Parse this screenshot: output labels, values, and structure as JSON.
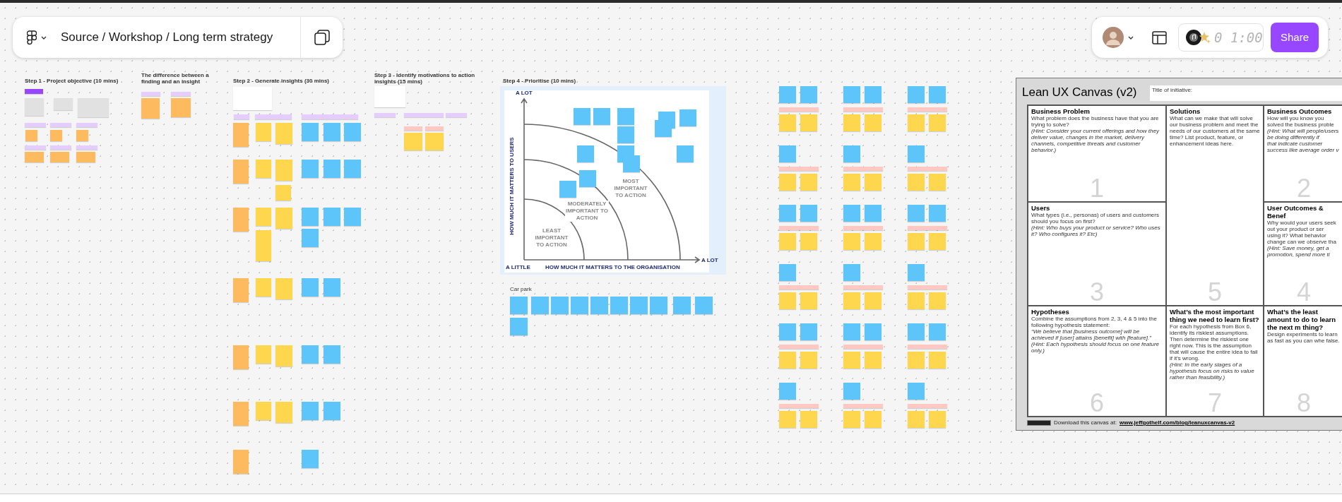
{
  "toolbar": {
    "file_path": "Source / Workshop / Long term strategy",
    "timer": "0 1:00",
    "share_button": "Share"
  },
  "sections": [
    {
      "title": "Step 1 - Project objective (10 mins)"
    },
    {
      "title": "The difference between a finding and an insight"
    },
    {
      "title": "Step 2 - Generate insights (30 mins)"
    },
    {
      "title": "Step 3 - Identify motivations to action insights (15 mins)"
    },
    {
      "title": "Step 4 - Prioritise (10 mins)"
    }
  ],
  "prioritisation_chart": {
    "y_max_label": "A LOT",
    "y_axis_label": "HOW MUCH IT MATTERS TO USERS",
    "origin_label": "A LITTLE",
    "x_axis_label": "HOW MUCH IT MATTERS TO THE ORGANISATION",
    "x_max_label": "A LOT",
    "zones": [
      "LEAST IMPORTANT TO ACTION",
      "MODERATELY IMPORTANT TO ACTION",
      "MOST IMPORTANT TO ACTION"
    ]
  },
  "car_park": {
    "title": "Car park"
  },
  "lean_ux_canvas": {
    "title": "Lean UX Canvas (v2)",
    "initiative_label": "Title of initiative:",
    "boxes": [
      {
        "number": "1",
        "heading": "Business Problem",
        "paragraphs": [
          {
            "text": "What problem does the business have that you are trying to solve?",
            "italic": false
          },
          {
            "text": "(Hint: Consider your current offerings and how they deliver value, changes in the market, delivery channels, competitive threats and customer behavior.)",
            "italic": true
          }
        ]
      },
      {
        "number": "5",
        "heading": "Solutions",
        "paragraphs": [
          {
            "text": "What can we make that will solve our business problem and meet the needs of our customers at the same time? List product, feature, or enhancement ideas here.",
            "italic": false
          }
        ]
      },
      {
        "number": "2",
        "heading": "Business Outcomes",
        "paragraphs": [
          {
            "text": "How will you know you solved the business proble",
            "italic": false
          },
          {
            "text": "(Hint: What will people/users be doing differently if",
            "italic": true
          },
          {
            "text": "that indicate customer success like average order v",
            "italic": true
          }
        ]
      },
      {
        "number": "3",
        "heading": "Users",
        "paragraphs": [
          {
            "text": "What types (i.e., personas) of users and customers should you focus on first?",
            "italic": false
          },
          {
            "text": "(Hint: Who buys your product or service? Who uses it? Who configures it? Etc)",
            "italic": true
          }
        ]
      },
      {
        "number": "4",
        "heading": "User Outcomes & Benef",
        "paragraphs": [
          {
            "text": "Why would your users seek out your product or ser",
            "italic": false
          },
          {
            "text": "using it? What behavior change can we observe tha",
            "italic": false
          },
          {
            "text": "(Hint: Save money, get a promotion, spend more ti",
            "italic": true
          }
        ]
      },
      {
        "number": "6",
        "heading": "Hypotheses",
        "paragraphs": [
          {
            "text": "Combine the assumptions from 2, 3, 4 & 5 into the following hypothesis statement:",
            "italic": false
          },
          {
            "text": "“We believe that [business outcome] will be achieved if [user] attains [benefit] with [feature].”",
            "italic": true
          },
          {
            "text": "(Hint: Each hypothesis should focus on one feature only.)",
            "italic": true
          }
        ]
      },
      {
        "number": "7",
        "heading": "What’s the most important thing we need to learn first?",
        "paragraphs": [
          {
            "text": "For each hypothesis from Box 6, identify its riskiest assumptions. Then determine the riskiest one right now. This is the assumption that will cause the entire idea to fail if it’s wrong.",
            "italic": false
          },
          {
            "text": "(Hint: In the early stages of a hypothesis focus on risks to value rather than feasibility.)",
            "italic": true
          }
        ]
      },
      {
        "number": "8",
        "heading": "What’s the least amount to do to learn the next m thing?",
        "paragraphs": [
          {
            "text": "Design experiments to learn as fast as you can whe false.",
            "italic": false
          }
        ]
      }
    ],
    "footer_text": "Download this canvas at:",
    "footer_link": "www.jeffgothelf.com/blog/leanuxcanvas-v2"
  }
}
